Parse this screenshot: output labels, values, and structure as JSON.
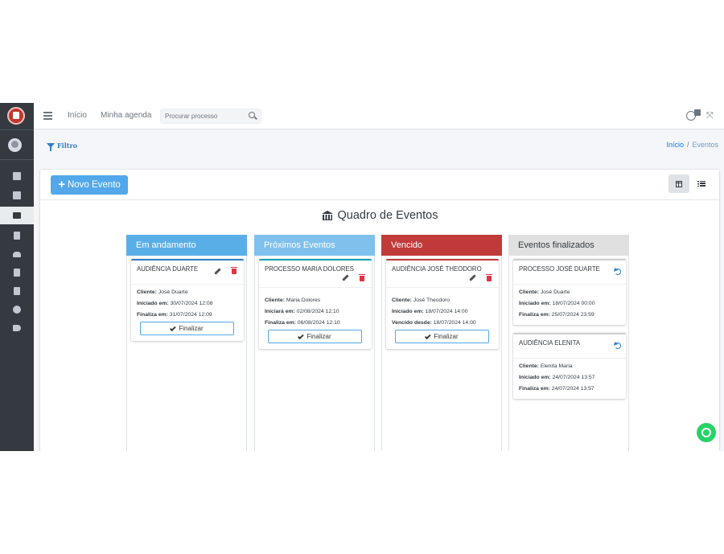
{
  "navbar": {
    "links": [
      "Início",
      "Minha agenda"
    ],
    "search_placeholder": "Procurar processo"
  },
  "content": {
    "filter_label": "Filtro",
    "breadcrumb": {
      "home": "Início",
      "separator": "/",
      "current": "Eventos"
    }
  },
  "toolbar": {
    "new_event_label": "Novo Evento"
  },
  "board": {
    "title": "Quadro de Eventos",
    "finalize_label": "Finalizar",
    "columns": [
      {
        "title": "Em andamento",
        "color": "#5aaee8",
        "events": [
          {
            "title": "AUDIÊNCIA DUARTE",
            "lines": [
              {
                "label": "Cliente:",
                "value": "José Duarte"
              },
              {
                "label": "Iniciado em:",
                "value": "30/07/2024 12:08"
              },
              {
                "label": "Finaliza em:",
                "value": "31/07/2024 12:09"
              }
            ]
          }
        ]
      },
      {
        "title": "Próximos Eventos",
        "color": "#7fc0ec",
        "events": [
          {
            "title": "PROCESSO MARIA DOLORES",
            "lines": [
              {
                "label": "Cliente:",
                "value": "Maria Dolores"
              },
              {
                "label": "Iniciará em:",
                "value": "02/08/2024 12:10"
              },
              {
                "label": "Finaliza em:",
                "value": "06/08/2024 12:10"
              }
            ]
          }
        ]
      },
      {
        "title": "Vencido",
        "color": "#c13a3a",
        "events": [
          {
            "title": "AUDIÊNCIA JOSÉ THEODORO",
            "lines": [
              {
                "label": "Cliente:",
                "value": "José Theodoro"
              },
              {
                "label": "Iniciado em:",
                "value": "18/07/2024 14:00"
              },
              {
                "label": "Vencido desde:",
                "value": "18/07/2024 14:00"
              }
            ]
          }
        ]
      },
      {
        "title": "Eventos finalizados",
        "color": "#e0e0e0",
        "events": [
          {
            "title": "PROCESSO JOSÉ DUARTE",
            "lines": [
              {
                "label": "Cliente:",
                "value": "José Duarte"
              },
              {
                "label": "Iniciado em:",
                "value": "18/07/2024 00:00"
              },
              {
                "label": "Finaliza em:",
                "value": "25/07/2024 23:59"
              }
            ]
          },
          {
            "title": "AUDIÊNCIA ELENITA",
            "lines": [
              {
                "label": "Cliente:",
                "value": "Elenita Maria"
              },
              {
                "label": "Iniciado em:",
                "value": "24/07/2024 13:57"
              },
              {
                "label": "Finaliza em:",
                "value": "24/07/2024 13:57"
              }
            ]
          }
        ]
      }
    ]
  }
}
